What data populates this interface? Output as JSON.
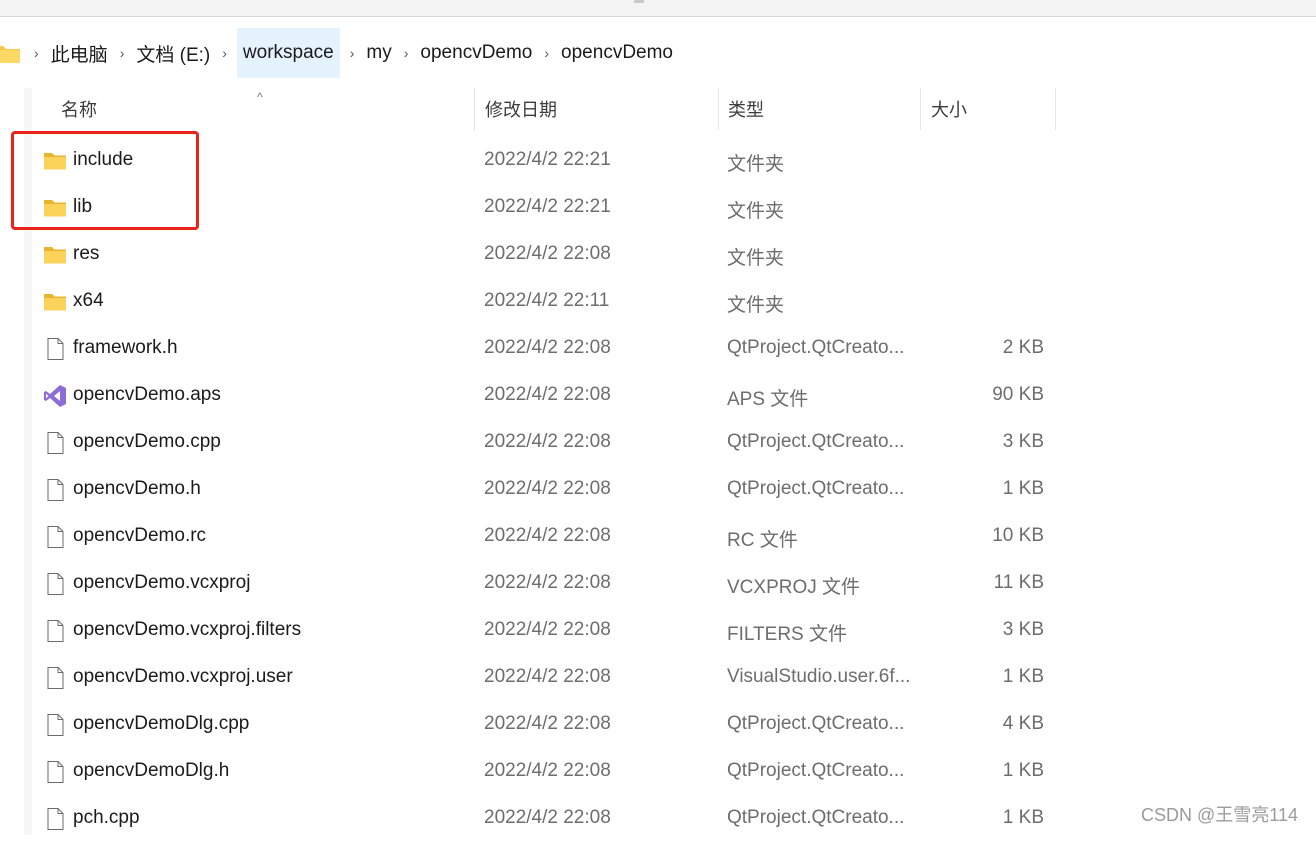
{
  "breadcrumb": [
    "此电脑",
    "文档 (E:)",
    "workspace",
    "my",
    "opencvDemo",
    "opencvDemo"
  ],
  "columns": {
    "name": "名称",
    "modified": "修改日期",
    "type": "类型",
    "size": "大小"
  },
  "rows": [
    {
      "name": "include",
      "date": "2022/4/2 22:21",
      "type": "文件夹",
      "size": "",
      "icon": "folder-icon"
    },
    {
      "name": "lib",
      "date": "2022/4/2 22:21",
      "type": "文件夹",
      "size": "",
      "icon": "folder-icon"
    },
    {
      "name": "res",
      "date": "2022/4/2 22:08",
      "type": "文件夹",
      "size": "",
      "icon": "folder-icon"
    },
    {
      "name": "x64",
      "date": "2022/4/2 22:11",
      "type": "文件夹",
      "size": "",
      "icon": "folder-icon"
    },
    {
      "name": "framework.h",
      "date": "2022/4/2 22:08",
      "type": "QtProject.QtCreato...",
      "size": "2 KB",
      "icon": "file-icon"
    },
    {
      "name": "opencvDemo.aps",
      "date": "2022/4/2 22:08",
      "type": "APS 文件",
      "size": "90 KB",
      "icon": "visual-studio-icon"
    },
    {
      "name": "opencvDemo.cpp",
      "date": "2022/4/2 22:08",
      "type": "QtProject.QtCreato...",
      "size": "3 KB",
      "icon": "file-icon"
    },
    {
      "name": "opencvDemo.h",
      "date": "2022/4/2 22:08",
      "type": "QtProject.QtCreato...",
      "size": "1 KB",
      "icon": "file-icon"
    },
    {
      "name": "opencvDemo.rc",
      "date": "2022/4/2 22:08",
      "type": "RC 文件",
      "size": "10 KB",
      "icon": "file-icon"
    },
    {
      "name": "opencvDemo.vcxproj",
      "date": "2022/4/2 22:08",
      "type": "VCXPROJ 文件",
      "size": "11 KB",
      "icon": "file-icon"
    },
    {
      "name": "opencvDemo.vcxproj.filters",
      "date": "2022/4/2 22:08",
      "type": "FILTERS 文件",
      "size": "3 KB",
      "icon": "file-icon"
    },
    {
      "name": "opencvDemo.vcxproj.user",
      "date": "2022/4/2 22:08",
      "type": "VisualStudio.user.6f...",
      "size": "1 KB",
      "icon": "file-icon"
    },
    {
      "name": "opencvDemoDlg.cpp",
      "date": "2022/4/2 22:08",
      "type": "QtProject.QtCreato...",
      "size": "4 KB",
      "icon": "file-icon"
    },
    {
      "name": "opencvDemoDlg.h",
      "date": "2022/4/2 22:08",
      "type": "QtProject.QtCreato...",
      "size": "1 KB",
      "icon": "file-icon"
    },
    {
      "name": "pch.cpp",
      "date": "2022/4/2 22:08",
      "type": "QtProject.QtCreato...",
      "size": "1 KB",
      "icon": "file-icon"
    }
  ],
  "watermark": "CSDN @王雪亮114",
  "colors": {
    "highlight": "#e8241a",
    "folder": "#f7c948",
    "vs": "#7e57c2"
  }
}
